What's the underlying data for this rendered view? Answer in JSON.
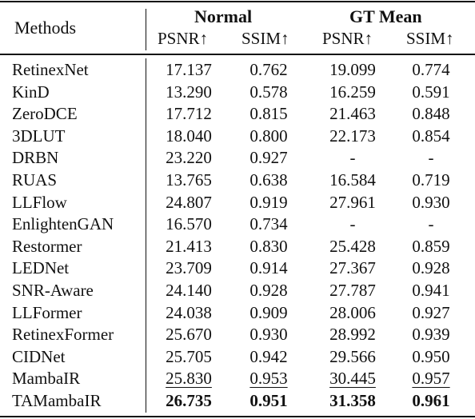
{
  "header": {
    "methods_label": "Methods",
    "groups": [
      "Normal",
      "GT Mean"
    ],
    "metrics": [
      "PSNR↑",
      "SSIM↑",
      "PSNR↑",
      "SSIM↑"
    ]
  },
  "rows": [
    {
      "method": "RetinexNet",
      "values": [
        "17.137",
        "0.762",
        "19.099",
        "0.774"
      ]
    },
    {
      "method": "KinD",
      "values": [
        "13.290",
        "0.578",
        "16.259",
        "0.591"
      ]
    },
    {
      "method": "ZeroDCE",
      "values": [
        "17.712",
        "0.815",
        "21.463",
        "0.848"
      ]
    },
    {
      "method": "3DLUT",
      "values": [
        "18.040",
        "0.800",
        "22.173",
        "0.854"
      ]
    },
    {
      "method": "DRBN",
      "values": [
        "23.220",
        "0.927",
        "-",
        "-"
      ]
    },
    {
      "method": "RUAS",
      "values": [
        "13.765",
        "0.638",
        "16.584",
        "0.719"
      ]
    },
    {
      "method": "LLFlow",
      "values": [
        "24.807",
        "0.919",
        "27.961",
        "0.930"
      ]
    },
    {
      "method": "EnlightenGAN",
      "values": [
        "16.570",
        "0.734",
        "-",
        "-"
      ]
    },
    {
      "method": "Restormer",
      "values": [
        "21.413",
        "0.830",
        "25.428",
        "0.859"
      ]
    },
    {
      "method": "LEDNet",
      "values": [
        "23.709",
        "0.914",
        "27.367",
        "0.928"
      ]
    },
    {
      "method": "SNR-Aware",
      "values": [
        "24.140",
        "0.928",
        "27.787",
        "0.941"
      ]
    },
    {
      "method": "LLFormer",
      "values": [
        "24.038",
        "0.909",
        "28.006",
        "0.927"
      ]
    },
    {
      "method": "RetinexFormer",
      "values": [
        "25.670",
        "0.930",
        "28.992",
        "0.939"
      ]
    },
    {
      "method": "CIDNet",
      "values": [
        "25.705",
        "0.942",
        "29.566",
        "0.950"
      ]
    },
    {
      "method": "MambaIR",
      "values": [
        "25.830",
        "0.953",
        "30.445",
        "0.957"
      ],
      "style": "underline"
    },
    {
      "method": "TAMambaIR",
      "values": [
        "26.735",
        "0.951",
        "31.358",
        "0.961"
      ],
      "style": "bold"
    }
  ]
}
